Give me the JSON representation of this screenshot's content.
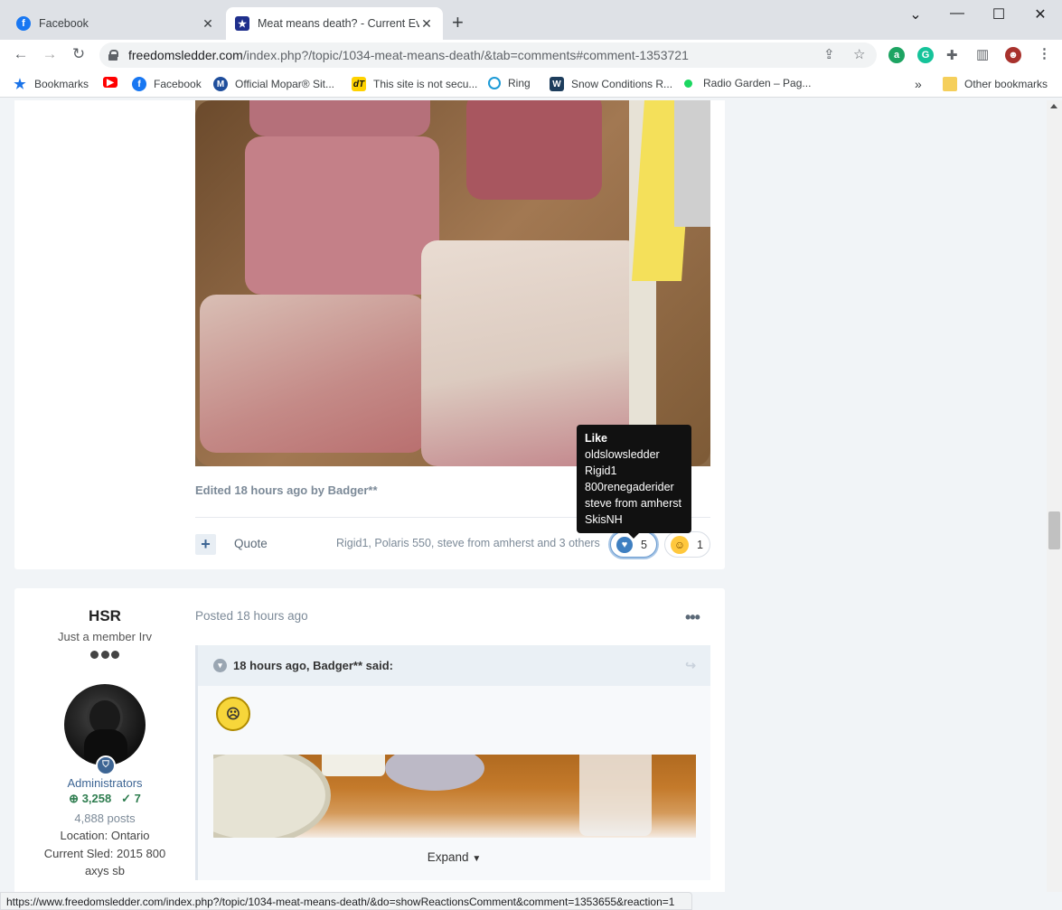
{
  "browser": {
    "tabs": [
      {
        "title": "Facebook",
        "icon": "facebook-icon",
        "active": false
      },
      {
        "title": "Meat means death? - Current Eve",
        "icon": "site-star-icon",
        "active": true
      }
    ],
    "url_main": "freedomsledder.com",
    "url_rest": "/index.php?/topic/1034-meat-means-death/&tab=comments#comment-1353721",
    "bookmarks": [
      {
        "label": "Bookmarks",
        "icon": "star-icon",
        "color": "#1a73e8"
      },
      {
        "label": "",
        "icon": "youtube-icon",
        "color": "#ff0000"
      },
      {
        "label": "Facebook",
        "icon": "facebook-icon",
        "color": "#1877f2"
      },
      {
        "label": "Official Mopar® Sit...",
        "icon": "mopar-icon",
        "color": "#1f4e9c"
      },
      {
        "label": "This site is not secu...",
        "icon": "dt-icon",
        "color": "#111111"
      },
      {
        "label": "Ring",
        "icon": "ring-icon",
        "color": "#1c9ad6"
      },
      {
        "label": "Snow Conditions R...",
        "icon": "wisconsin-icon",
        "color": "#1d3d5c"
      },
      {
        "label": "Radio Garden – Pag...",
        "icon": "radio-garden-icon",
        "color": "#1bd760"
      }
    ],
    "other_bookmarks": "Other bookmarks",
    "status_url": "https://www.freedomsledder.com/index.php?/topic/1034-meat-means-death/&do=showReactionsComment&comment=1353655&reaction=1"
  },
  "post1": {
    "edited": "Edited 18 hours ago by Badger**",
    "quote_label": "Quote",
    "reactors": "Rigid1, Polaris 550, steve from amherst and 3 others",
    "like_count": "5",
    "laugh_count": "1",
    "tooltip": {
      "title": "Like",
      "users": [
        "oldslowsledder",
        "Rigid1",
        "800renegaderider",
        "steve from amherst",
        "SkisNH"
      ]
    }
  },
  "post2": {
    "author": "HSR",
    "author_title": "Just a member Irv",
    "group": "Administrators",
    "rep_positive": "3,258",
    "rep_solutions": "7",
    "posts": "4,888 posts",
    "location": "Location: Ontario",
    "sled_line1": "Current Sled: 2015 800",
    "sled_line2": "axys sb",
    "posted": "Posted 18 hours ago",
    "quote_header": "18 hours ago, Badger** said:",
    "expand": "Expand"
  },
  "colors": {
    "accent": "#3d6594",
    "like_blue": "#3e7fc1",
    "rep_green": "#2e7d4f"
  }
}
